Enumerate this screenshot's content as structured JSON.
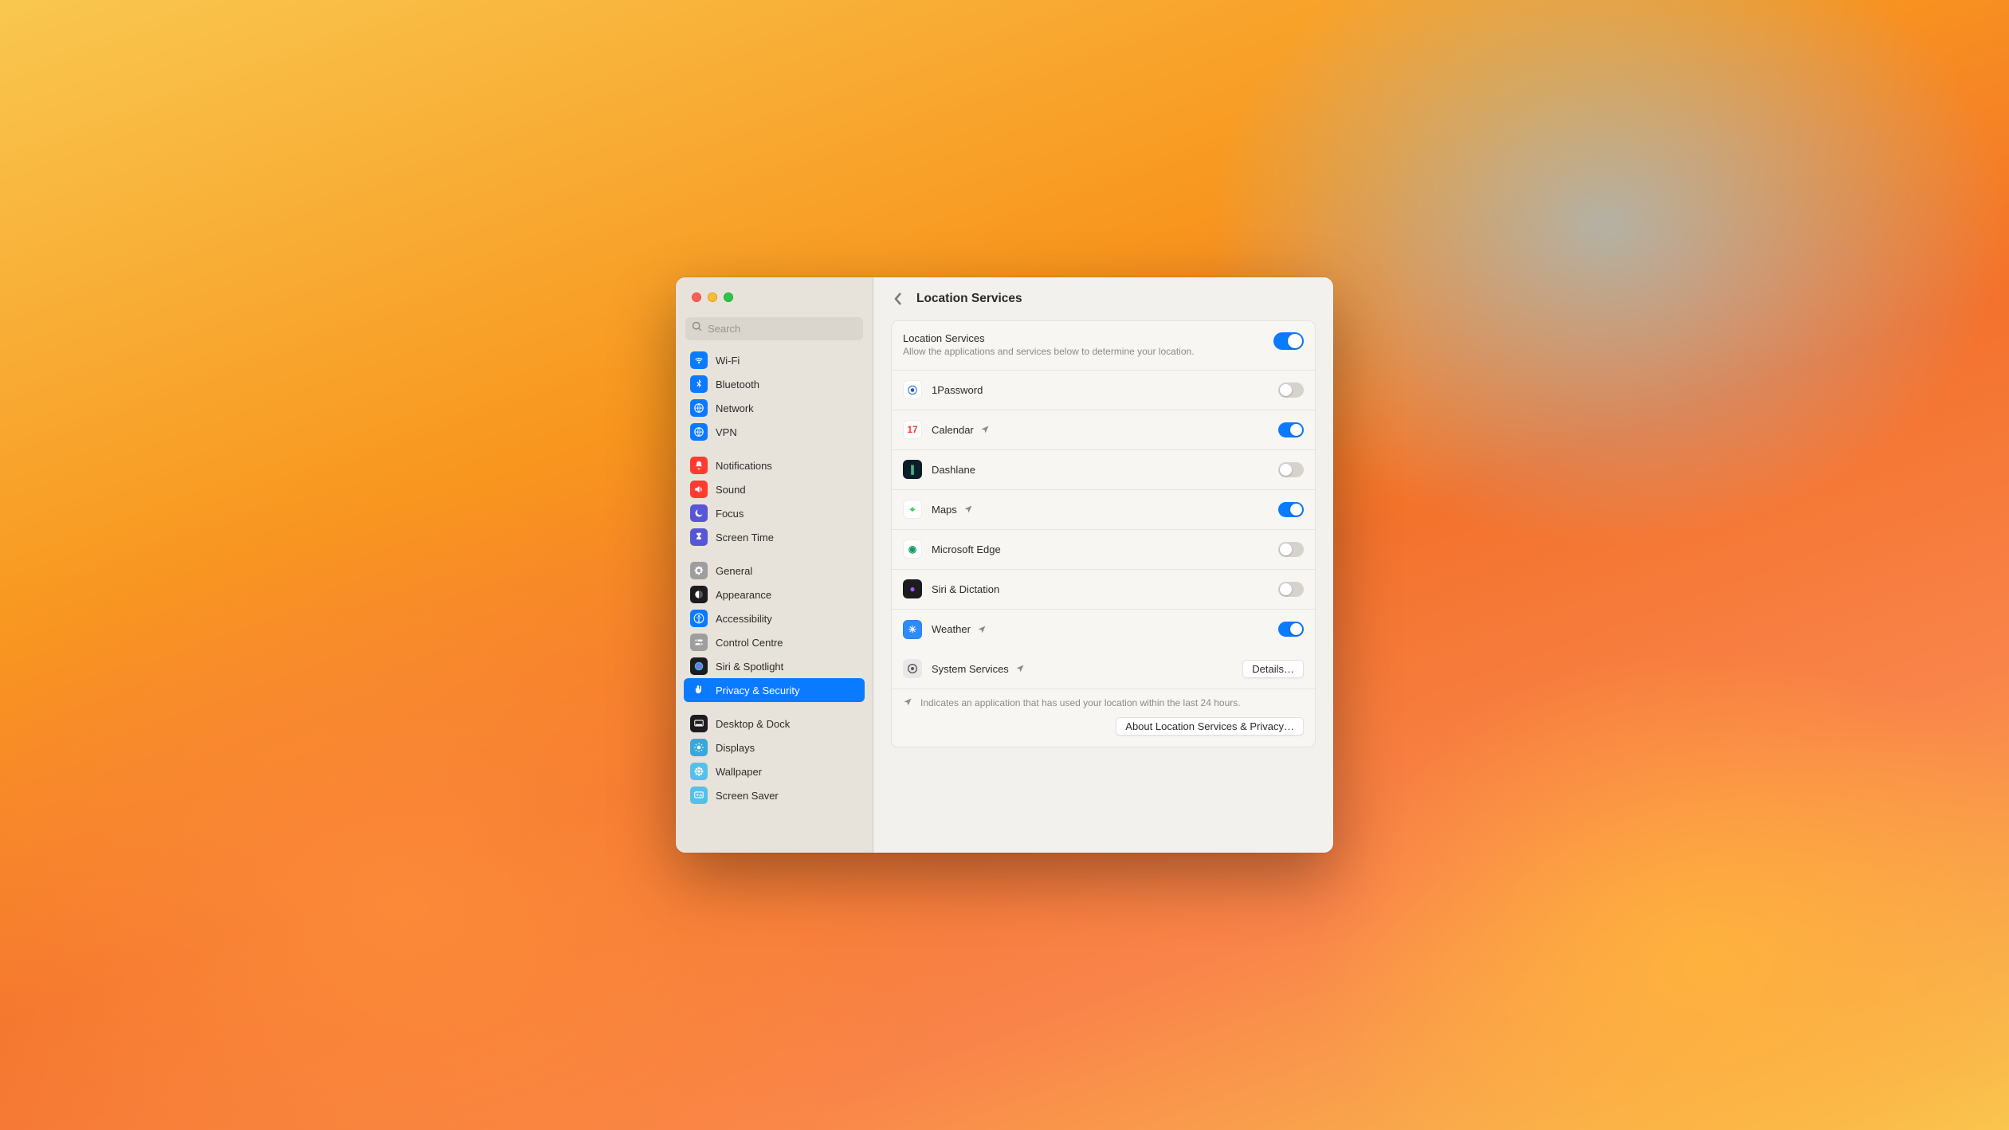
{
  "search": {
    "placeholder": "Search"
  },
  "sidebar": {
    "groups": [
      {
        "items": [
          {
            "label": "Wi-Fi",
            "icon": "wifi",
            "color": "#0a7aff"
          },
          {
            "label": "Bluetooth",
            "icon": "bluetooth",
            "color": "#0a7aff"
          },
          {
            "label": "Network",
            "icon": "globe",
            "color": "#0a7aff"
          },
          {
            "label": "VPN",
            "icon": "globe",
            "color": "#0a7aff"
          }
        ]
      },
      {
        "items": [
          {
            "label": "Notifications",
            "icon": "bell",
            "color": "#ff3b30"
          },
          {
            "label": "Sound",
            "icon": "speaker",
            "color": "#ff3b30"
          },
          {
            "label": "Focus",
            "icon": "moon",
            "color": "#5856d6"
          },
          {
            "label": "Screen Time",
            "icon": "hourglass",
            "color": "#5856d6"
          }
        ]
      },
      {
        "items": [
          {
            "label": "General",
            "icon": "gear",
            "color": "#9e9e9e"
          },
          {
            "label": "Appearance",
            "icon": "appearance",
            "color": "#1c1c1e"
          },
          {
            "label": "Accessibility",
            "icon": "accessibility",
            "color": "#0a7aff"
          },
          {
            "label": "Control Centre",
            "icon": "switches",
            "color": "#9e9e9e"
          },
          {
            "label": "Siri & Spotlight",
            "icon": "siri",
            "color": "#1c1c1e"
          },
          {
            "label": "Privacy & Security",
            "icon": "hand",
            "color": "#0a7aff",
            "selected": true
          }
        ]
      },
      {
        "items": [
          {
            "label": "Desktop & Dock",
            "icon": "dock",
            "color": "#1c1c1e"
          },
          {
            "label": "Displays",
            "icon": "sun",
            "color": "#34aadc"
          },
          {
            "label": "Wallpaper",
            "icon": "flower",
            "color": "#55c1e8"
          },
          {
            "label": "Screen Saver",
            "icon": "screensaver",
            "color": "#55c1e8"
          }
        ]
      }
    ]
  },
  "header": {
    "title": "Location Services"
  },
  "main": {
    "toggle_label": "Location Services",
    "toggle_desc": "Allow the applications and services below to determine your location.",
    "master_on": true,
    "apps": [
      {
        "name": "1Password",
        "icon_bg": "#ffffff",
        "icon_fg": "#1a57d6",
        "glyph": "⦿",
        "recent": false,
        "on": false
      },
      {
        "name": "Calendar",
        "icon_bg": "#ffffff",
        "icon_fg": "#ff3b30",
        "glyph": "17",
        "recent": true,
        "on": true
      },
      {
        "name": "Dashlane",
        "icon_bg": "#0b1f2a",
        "icon_fg": "#58d6a0",
        "glyph": "∥",
        "recent": false,
        "on": false
      },
      {
        "name": "Maps",
        "icon_bg": "#ffffff",
        "icon_fg": "#34c759",
        "glyph": "⌖",
        "recent": true,
        "on": true
      },
      {
        "name": "Microsoft Edge",
        "icon_bg": "#ffffff",
        "icon_fg": "#0f9d58",
        "glyph": "◉",
        "recent": false,
        "on": false
      },
      {
        "name": "Siri & Dictation",
        "icon_bg": "#1c1c1e",
        "icon_fg": "#a259ff",
        "glyph": "●",
        "recent": false,
        "on": false
      },
      {
        "name": "Weather",
        "icon_bg": "#2e8bff",
        "icon_fg": "#ffffff",
        "glyph": "☀",
        "recent": true,
        "on": true
      }
    ],
    "system_services_label": "System Services",
    "details_button": "Details…",
    "legend": "Indicates an application that has used your location within the last 24 hours.",
    "about_button": "About Location Services & Privacy…"
  }
}
